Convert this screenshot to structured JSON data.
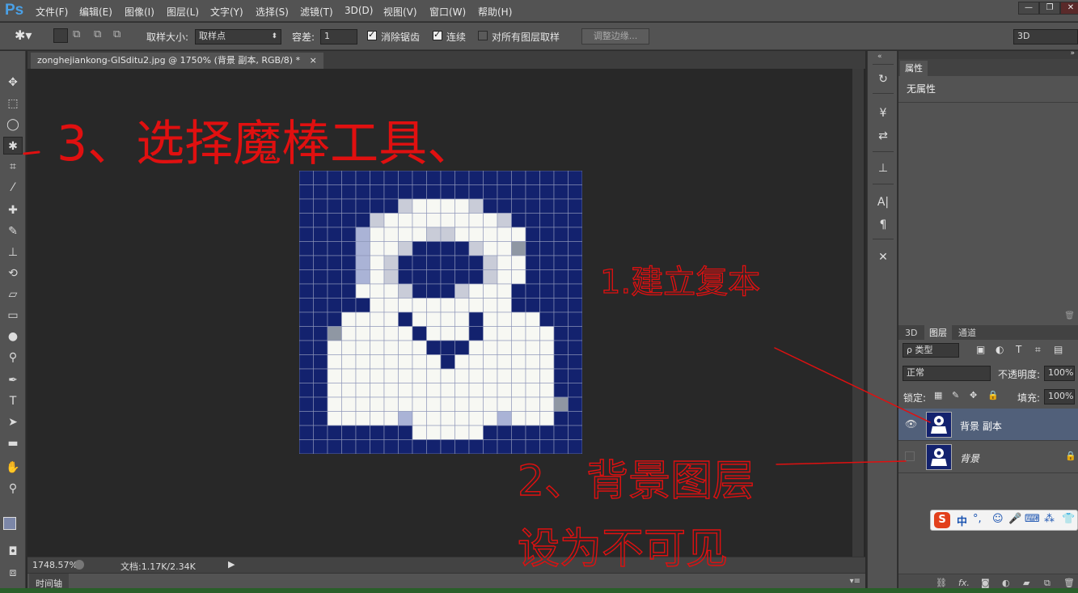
{
  "app": {
    "logo": "Ps"
  },
  "menu": [
    "文件(F)",
    "编辑(E)",
    "图像(I)",
    "图层(L)",
    "文字(Y)",
    "选择(S)",
    "滤镜(T)",
    "3D(D)",
    "视图(V)",
    "窗口(W)",
    "帮助(H)"
  ],
  "window_controls": {
    "minimize": "—",
    "restore": "❐",
    "close": "✕"
  },
  "options": {
    "sample_size_label": "取样大小:",
    "sample_size_value": "取样点",
    "tolerance_label": "容差:",
    "tolerance_value": "1",
    "antialias_label": "消除锯齿",
    "antialias_checked": true,
    "contiguous_label": "连续",
    "contiguous_checked": true,
    "sample_all_label": "对所有图层取样",
    "sample_all_checked": false,
    "refine_edge_label": "调整边缘...",
    "workspace_value": "3D"
  },
  "document": {
    "tab_title": "zonghejiankong-GISditu2.jpg @ 1750% (背景 副本, RGB/8) *",
    "close_glyph": "×",
    "zoom": "1748.57%",
    "doc_size": "文档:1.17K/2.34K"
  },
  "timeline_label": "时间轴",
  "properties": {
    "tab": "属性",
    "content": "无属性"
  },
  "layers_panel": {
    "tabs": [
      "3D",
      "图层",
      "通道"
    ],
    "active_tab": "图层",
    "filter_label": "ρ 类型",
    "blend_mode": "正常",
    "opacity_label": "不透明度:",
    "opacity_value": "100%",
    "lock_label": "锁定:",
    "fill_label": "填充:",
    "fill_value": "100%",
    "layers": [
      {
        "name": "背景 副本",
        "visible": true,
        "selected": true,
        "locked": false
      },
      {
        "name": "背景",
        "visible": false,
        "selected": false,
        "locked": true
      }
    ],
    "footer_icons": [
      "link-icon",
      "fx-icon",
      "mask-icon",
      "adjustment-icon",
      "folder-icon",
      "new-layer-icon",
      "trash-icon"
    ],
    "footer_fx": "fx."
  },
  "ime_toolbar": {
    "logo": "S",
    "lang": "中",
    "punct": "°,"
  },
  "annotations": {
    "step3": "3、选择魔棒工具、",
    "step1": "1.建立复本",
    "step2_line1": "2、背景图层",
    "step2_line2": "设为不可见"
  },
  "colors": {
    "annotation_red": "#e01010",
    "image_navy": "#13226e",
    "image_white": "#f6f7f2",
    "panel_bg": "#535353",
    "canvas_bg": "#282828",
    "selected_layer": "#51607a"
  },
  "pixel_image": {
    "grid_size": 20,
    "rows": [
      "NNNNNNNNNNNNNNNNNNNN",
      "NNNNNNNNNNNNNNNNNNNN",
      "NNNNNNNSWWWWSNNNNNNN",
      "NNNNNSWWWWWWWWSNNNNN",
      "NNNNLWWWWSSWWWWWNNNN",
      "NNNNLWWSNNNNSWWGNNNN",
      "NNNNLWSNNNNNNSWWNNNN",
      "NNNNLWSNNNNNNSWWNNNN",
      "NNNNWWWSNNNSWWWNNNNN",
      "NNNNNWWWWWWWWWWNNNNN",
      "NNNWWWWNWWWWNWWWWNNN",
      "NNGWWWWWNWWWNWWWWWNN",
      "NNWWWWWWWNNNWWWWWWNN",
      "NNWWWWWWWWNWWWWWWWNN",
      "NNWWWWWWWWWWWWWWWWNN",
      "NNWWWWWWWWWWWWWWWWNN",
      "NNWWWWWWWWWWWWWWWWGN",
      "NNWWWWWLWWWWWWLWWWNN",
      "NNNNNNNNWWWWWNNNNNNN",
      "NNNNNNNNNNNNNNNNNNNN"
    ],
    "palette": {
      "N": "#13226e",
      "W": "#f7f8f3",
      "S": "#c9ccd8",
      "L": "#aab3d6",
      "G": "#8f97a3"
    }
  }
}
